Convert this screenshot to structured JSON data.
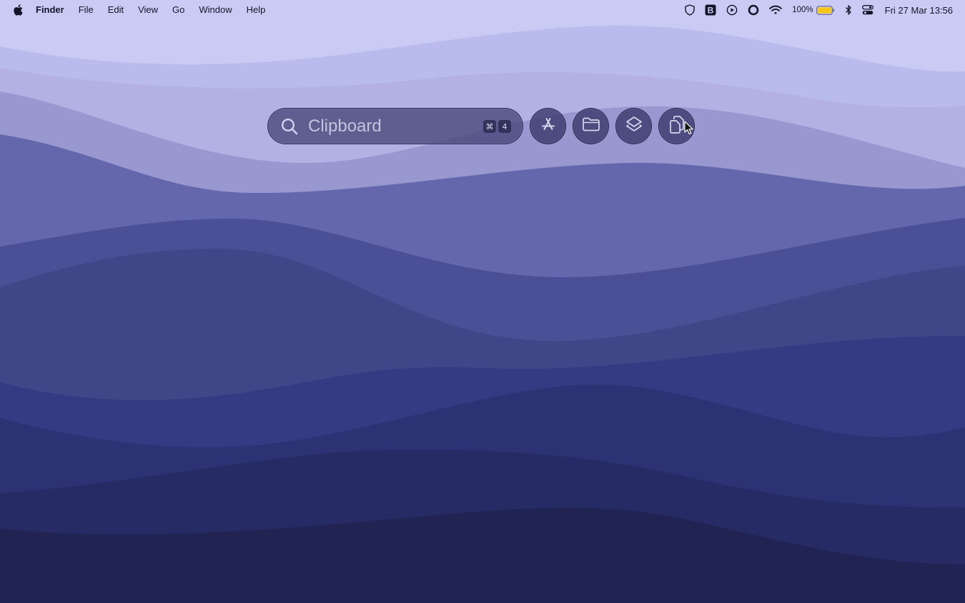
{
  "menubar": {
    "app_name": "Finder",
    "menus": [
      "File",
      "Edit",
      "View",
      "Go",
      "Window",
      "Help"
    ],
    "status_icons": [
      "vpn-shield-icon",
      "bold-b-app-icon",
      "play-circle-icon",
      "record-circle-icon",
      "wifi-icon",
      "bluetooth-icon",
      "control-center-icon"
    ],
    "battery_percent": "100%",
    "datetime": "Fri 27 Mar  13:56"
  },
  "launcher": {
    "search_placeholder": "Clipboard",
    "shortcut_modifier": "⌘",
    "shortcut_key": "4",
    "buttons": [
      {
        "name": "applications",
        "icon": "app-store-icon"
      },
      {
        "name": "files",
        "icon": "folder-icon"
      },
      {
        "name": "actions",
        "icon": "layers-icon"
      },
      {
        "name": "clipboard",
        "icon": "clipboard-icon"
      }
    ]
  },
  "colors": {
    "menubar_text": "#15152a",
    "wallpaper_top": "#c8cbf3",
    "wallpaper_bottom": "#1f1f4a",
    "battery_fill": "#f5c518"
  }
}
